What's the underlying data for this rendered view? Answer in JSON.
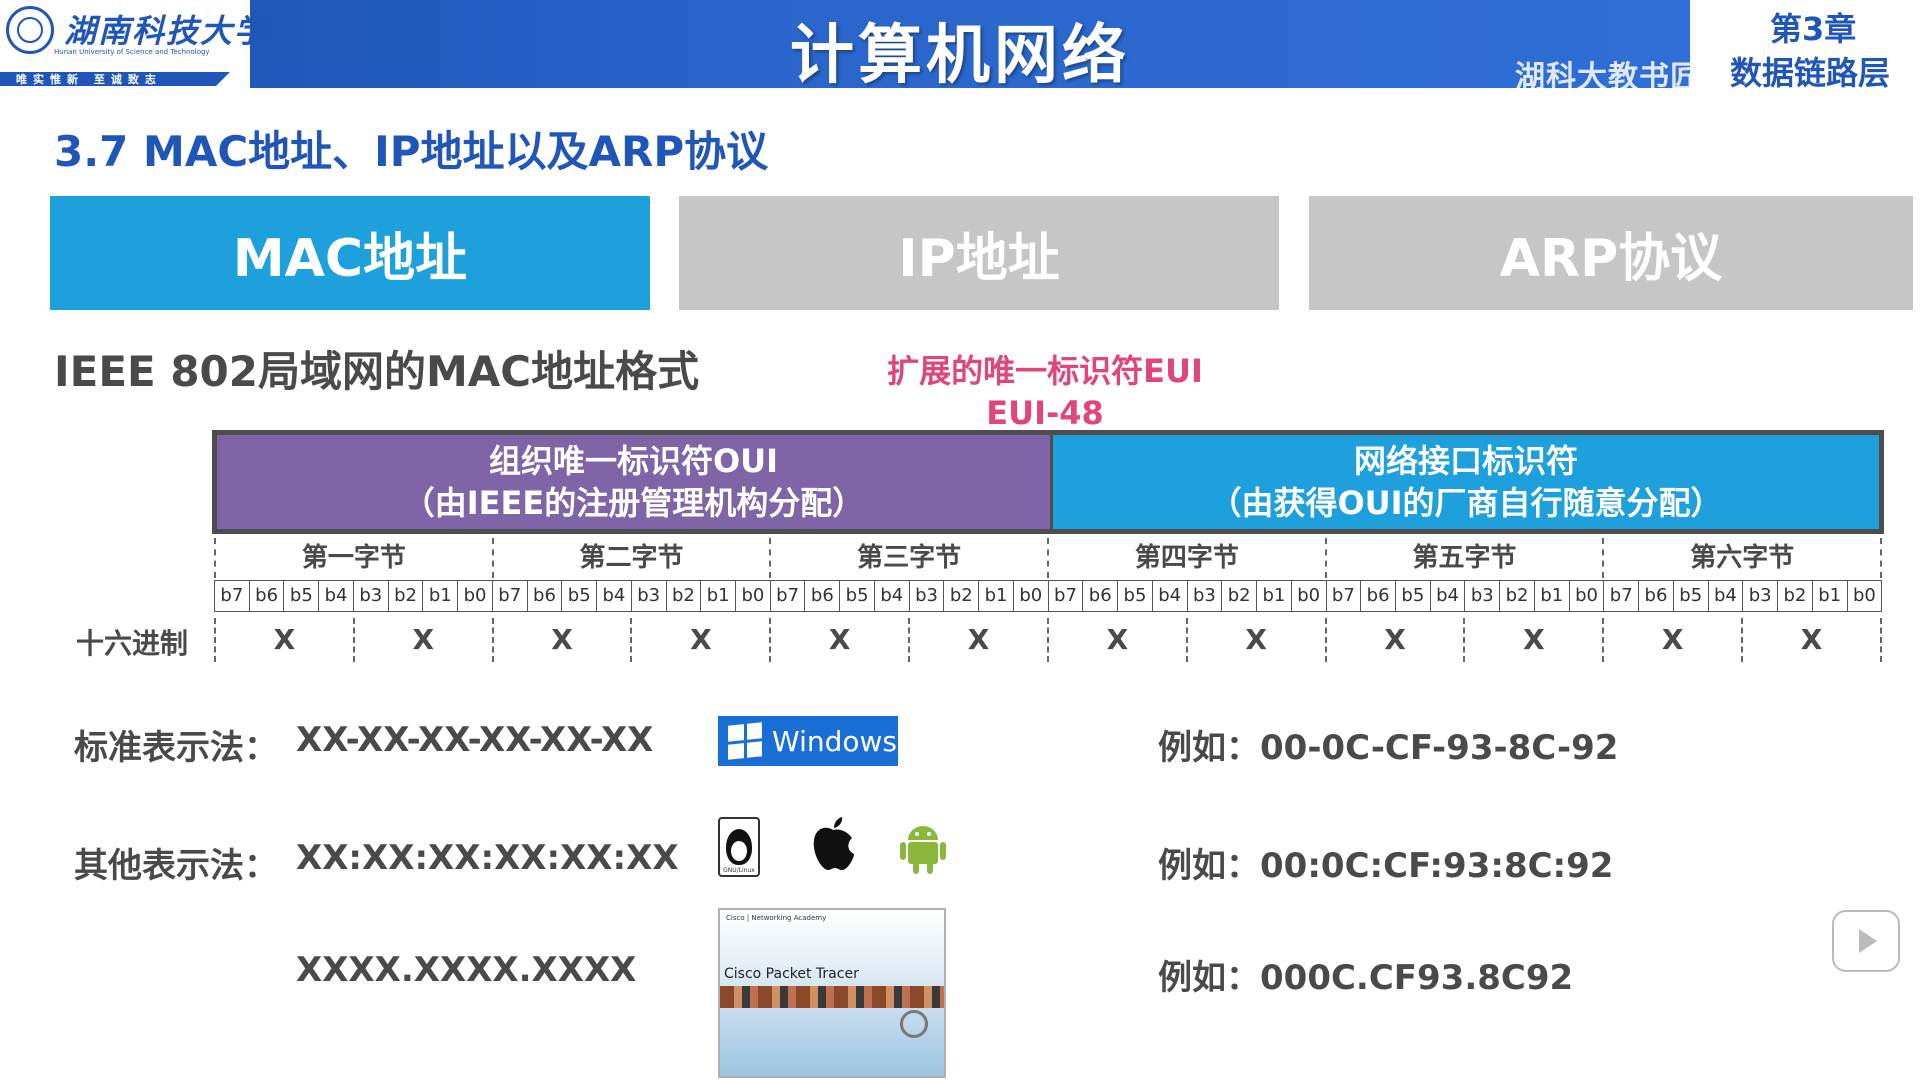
{
  "header": {
    "university_name": "湖南科技大学",
    "university_en": "Hunan University of Science and Technology",
    "motto": "唯实惟新 至诚致志",
    "course_title": "计算机网络",
    "chapter_number": "第3章",
    "chapter_name": "数据链路层",
    "watermark": "湖科大教书匠"
  },
  "section_title": "3.7 MAC地址、IP地址以及ARP协议",
  "tabs": [
    {
      "label": "MAC地址",
      "active": true
    },
    {
      "label": "IP地址",
      "active": false
    },
    {
      "label": "ARP协议",
      "active": false
    }
  ],
  "subtitle": "IEEE 802局域网的MAC地址格式",
  "eui_note": {
    "line1": "扩展的唯一标识符EUI",
    "line2": "EUI-48"
  },
  "mac_format": {
    "oui": {
      "line1": "组织唯一标识符OUI",
      "line2": "（由IEEE的注册管理机构分配）"
    },
    "nic": {
      "line1": "网络接口标识符",
      "line2": "（由获得OUI的厂商自行随意分配）"
    },
    "bytes": [
      "第一字节",
      "第二字节",
      "第三字节",
      "第四字节",
      "第五字节",
      "第六字节"
    ],
    "bits": [
      "b7",
      "b6",
      "b5",
      "b4",
      "b3",
      "b2",
      "b1",
      "b0"
    ],
    "hex_label": "十六进制",
    "hex_digits": [
      "X",
      "X",
      "X",
      "X",
      "X",
      "X",
      "X",
      "X",
      "X",
      "X",
      "X",
      "X"
    ]
  },
  "notations": {
    "standard": {
      "label": "标准表示法：",
      "format": "XX-XX-XX-XX-XX-XX",
      "example": "例如：00-0C-CF-93-8C-92",
      "os": "Windows"
    },
    "other": {
      "label": "其他表示法：",
      "format": "XX:XX:XX:XX:XX:XX",
      "example": "例如：00:0C:CF:93:8C:92",
      "linux_caption": "GNU/Linux"
    },
    "cisco": {
      "format": "XXXX.XXXX.XXXX",
      "example": "例如：000C.CF93.8C92",
      "pt_top": "Cisco | Networking Academy",
      "pt_name": "Cisco Packet Tracer"
    }
  },
  "colors": {
    "header_blue": "#1f56b8",
    "tab_active": "#1da0db",
    "tab_inactive": "#c6c6c6",
    "oui_purple": "#8064a8",
    "nic_blue": "#1da0db",
    "eui_pink": "#e0457b"
  },
  "icons": [
    "university-logo",
    "windows-icon",
    "linux-icon",
    "apple-icon",
    "android-icon",
    "play-icon"
  ]
}
